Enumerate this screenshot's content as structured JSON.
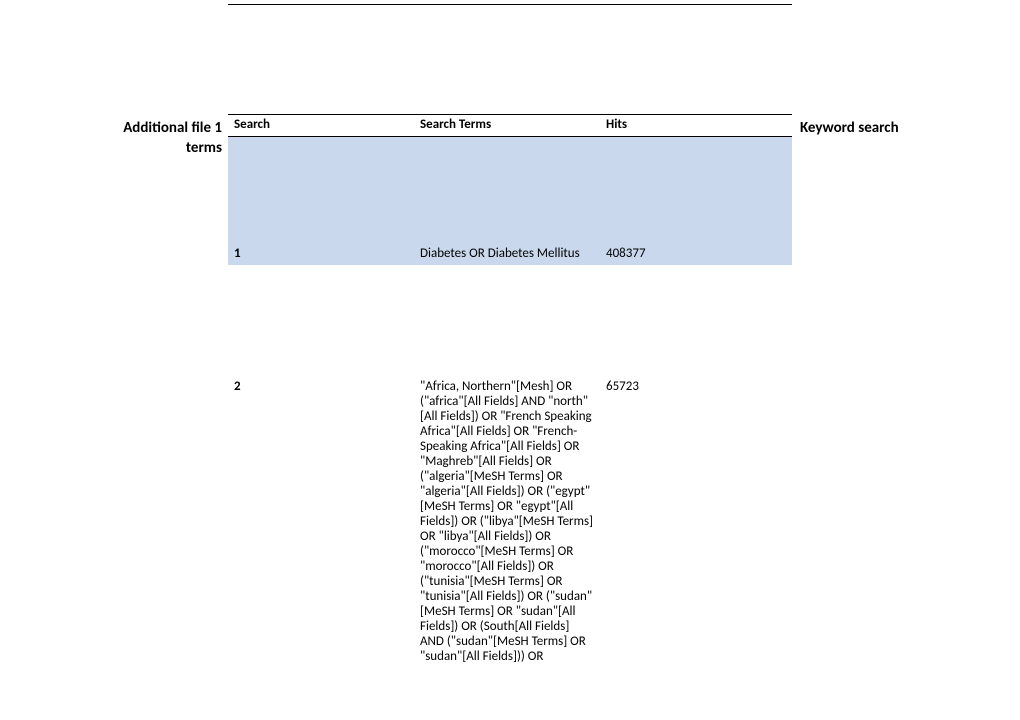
{
  "sidebar": {
    "left_label_line1": "Additional file 1",
    "left_label_line2": "terms",
    "right_label": "Keyword search"
  },
  "table": {
    "headers": {
      "search": "Search",
      "terms": "Search Terms",
      "hits": "Hits"
    },
    "rows": [
      {
        "search": "1",
        "terms": "Diabetes OR Diabetes Mellitus",
        "hits": "408377",
        "highlight": true
      },
      {
        "search": "2",
        "terms": "\"Africa, Northern\"[Mesh] OR (\"africa\"[All Fields] AND \"north\"[All Fields]) OR \"French Speaking Africa\"[All Fields] OR \"French-Speaking Africa\"[All Fields] OR \"Maghreb\"[All Fields] OR (\"algeria\"[MeSH Terms] OR \"algeria\"[All Fields]) OR (\"egypt\"[MeSH Terms] OR \"egypt\"[All Fields]) OR (\"libya\"[MeSH Terms] OR \"libya\"[All Fields]) OR (\"morocco\"[MeSH Terms] OR \"morocco\"[All Fields]) OR (\"tunisia\"[MeSH Terms] OR \"tunisia\"[All Fields]) OR (\"sudan\"[MeSH Terms] OR \"sudan\"[All Fields]) OR (South[All Fields] AND (\"sudan\"[MeSH Terms] OR \"sudan\"[All Fields])) OR",
        "hits": "65723",
        "highlight": false
      }
    ]
  }
}
